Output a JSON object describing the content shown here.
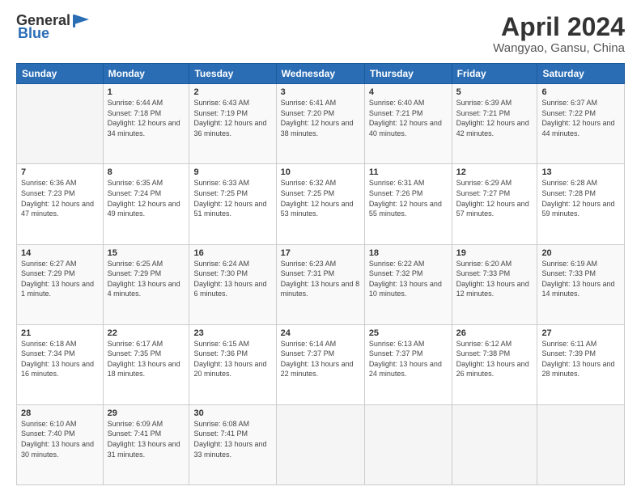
{
  "header": {
    "logo_general": "General",
    "logo_blue": "Blue",
    "title": "April 2024",
    "location": "Wangyao, Gansu, China"
  },
  "days_of_week": [
    "Sunday",
    "Monday",
    "Tuesday",
    "Wednesday",
    "Thursday",
    "Friday",
    "Saturday"
  ],
  "weeks": [
    [
      {
        "day": "",
        "sunrise": "",
        "sunset": "",
        "daylight": ""
      },
      {
        "day": "1",
        "sunrise": "Sunrise: 6:44 AM",
        "sunset": "Sunset: 7:18 PM",
        "daylight": "Daylight: 12 hours and 34 minutes."
      },
      {
        "day": "2",
        "sunrise": "Sunrise: 6:43 AM",
        "sunset": "Sunset: 7:19 PM",
        "daylight": "Daylight: 12 hours and 36 minutes."
      },
      {
        "day": "3",
        "sunrise": "Sunrise: 6:41 AM",
        "sunset": "Sunset: 7:20 PM",
        "daylight": "Daylight: 12 hours and 38 minutes."
      },
      {
        "day": "4",
        "sunrise": "Sunrise: 6:40 AM",
        "sunset": "Sunset: 7:21 PM",
        "daylight": "Daylight: 12 hours and 40 minutes."
      },
      {
        "day": "5",
        "sunrise": "Sunrise: 6:39 AM",
        "sunset": "Sunset: 7:21 PM",
        "daylight": "Daylight: 12 hours and 42 minutes."
      },
      {
        "day": "6",
        "sunrise": "Sunrise: 6:37 AM",
        "sunset": "Sunset: 7:22 PM",
        "daylight": "Daylight: 12 hours and 44 minutes."
      }
    ],
    [
      {
        "day": "7",
        "sunrise": "Sunrise: 6:36 AM",
        "sunset": "Sunset: 7:23 PM",
        "daylight": "Daylight: 12 hours and 47 minutes."
      },
      {
        "day": "8",
        "sunrise": "Sunrise: 6:35 AM",
        "sunset": "Sunset: 7:24 PM",
        "daylight": "Daylight: 12 hours and 49 minutes."
      },
      {
        "day": "9",
        "sunrise": "Sunrise: 6:33 AM",
        "sunset": "Sunset: 7:25 PM",
        "daylight": "Daylight: 12 hours and 51 minutes."
      },
      {
        "day": "10",
        "sunrise": "Sunrise: 6:32 AM",
        "sunset": "Sunset: 7:25 PM",
        "daylight": "Daylight: 12 hours and 53 minutes."
      },
      {
        "day": "11",
        "sunrise": "Sunrise: 6:31 AM",
        "sunset": "Sunset: 7:26 PM",
        "daylight": "Daylight: 12 hours and 55 minutes."
      },
      {
        "day": "12",
        "sunrise": "Sunrise: 6:29 AM",
        "sunset": "Sunset: 7:27 PM",
        "daylight": "Daylight: 12 hours and 57 minutes."
      },
      {
        "day": "13",
        "sunrise": "Sunrise: 6:28 AM",
        "sunset": "Sunset: 7:28 PM",
        "daylight": "Daylight: 12 hours and 59 minutes."
      }
    ],
    [
      {
        "day": "14",
        "sunrise": "Sunrise: 6:27 AM",
        "sunset": "Sunset: 7:29 PM",
        "daylight": "Daylight: 13 hours and 1 minute."
      },
      {
        "day": "15",
        "sunrise": "Sunrise: 6:25 AM",
        "sunset": "Sunset: 7:29 PM",
        "daylight": "Daylight: 13 hours and 4 minutes."
      },
      {
        "day": "16",
        "sunrise": "Sunrise: 6:24 AM",
        "sunset": "Sunset: 7:30 PM",
        "daylight": "Daylight: 13 hours and 6 minutes."
      },
      {
        "day": "17",
        "sunrise": "Sunrise: 6:23 AM",
        "sunset": "Sunset: 7:31 PM",
        "daylight": "Daylight: 13 hours and 8 minutes."
      },
      {
        "day": "18",
        "sunrise": "Sunrise: 6:22 AM",
        "sunset": "Sunset: 7:32 PM",
        "daylight": "Daylight: 13 hours and 10 minutes."
      },
      {
        "day": "19",
        "sunrise": "Sunrise: 6:20 AM",
        "sunset": "Sunset: 7:33 PM",
        "daylight": "Daylight: 13 hours and 12 minutes."
      },
      {
        "day": "20",
        "sunrise": "Sunrise: 6:19 AM",
        "sunset": "Sunset: 7:33 PM",
        "daylight": "Daylight: 13 hours and 14 minutes."
      }
    ],
    [
      {
        "day": "21",
        "sunrise": "Sunrise: 6:18 AM",
        "sunset": "Sunset: 7:34 PM",
        "daylight": "Daylight: 13 hours and 16 minutes."
      },
      {
        "day": "22",
        "sunrise": "Sunrise: 6:17 AM",
        "sunset": "Sunset: 7:35 PM",
        "daylight": "Daylight: 13 hours and 18 minutes."
      },
      {
        "day": "23",
        "sunrise": "Sunrise: 6:15 AM",
        "sunset": "Sunset: 7:36 PM",
        "daylight": "Daylight: 13 hours and 20 minutes."
      },
      {
        "day": "24",
        "sunrise": "Sunrise: 6:14 AM",
        "sunset": "Sunset: 7:37 PM",
        "daylight": "Daylight: 13 hours and 22 minutes."
      },
      {
        "day": "25",
        "sunrise": "Sunrise: 6:13 AM",
        "sunset": "Sunset: 7:37 PM",
        "daylight": "Daylight: 13 hours and 24 minutes."
      },
      {
        "day": "26",
        "sunrise": "Sunrise: 6:12 AM",
        "sunset": "Sunset: 7:38 PM",
        "daylight": "Daylight: 13 hours and 26 minutes."
      },
      {
        "day": "27",
        "sunrise": "Sunrise: 6:11 AM",
        "sunset": "Sunset: 7:39 PM",
        "daylight": "Daylight: 13 hours and 28 minutes."
      }
    ],
    [
      {
        "day": "28",
        "sunrise": "Sunrise: 6:10 AM",
        "sunset": "Sunset: 7:40 PM",
        "daylight": "Daylight: 13 hours and 30 minutes."
      },
      {
        "day": "29",
        "sunrise": "Sunrise: 6:09 AM",
        "sunset": "Sunset: 7:41 PM",
        "daylight": "Daylight: 13 hours and 31 minutes."
      },
      {
        "day": "30",
        "sunrise": "Sunrise: 6:08 AM",
        "sunset": "Sunset: 7:41 PM",
        "daylight": "Daylight: 13 hours and 33 minutes."
      },
      {
        "day": "",
        "sunrise": "",
        "sunset": "",
        "daylight": ""
      },
      {
        "day": "",
        "sunrise": "",
        "sunset": "",
        "daylight": ""
      },
      {
        "day": "",
        "sunrise": "",
        "sunset": "",
        "daylight": ""
      },
      {
        "day": "",
        "sunrise": "",
        "sunset": "",
        "daylight": ""
      }
    ]
  ]
}
